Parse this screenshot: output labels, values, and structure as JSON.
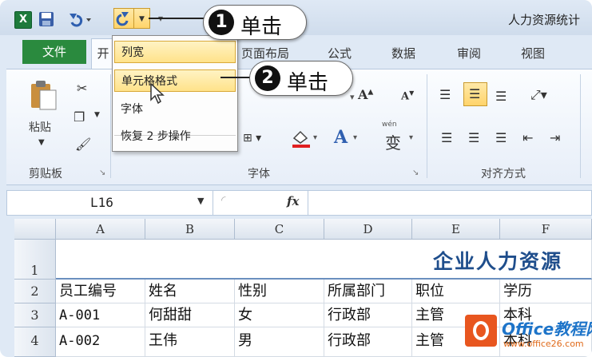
{
  "titlebar": {
    "doc_title": "人力资源统计"
  },
  "tabs": [
    {
      "label": "文件"
    },
    {
      "label": "开"
    },
    {
      "label": "页面布局"
    },
    {
      "label": "公式"
    },
    {
      "label": "数据"
    },
    {
      "label": "审阅"
    },
    {
      "label": "视图"
    }
  ],
  "menu": {
    "items": [
      {
        "label": "列宽"
      },
      {
        "label": "单元格格式"
      },
      {
        "label": "字体"
      },
      {
        "label": "恢复 2 步操作"
      }
    ]
  },
  "callouts": [
    {
      "number": "1",
      "text": "单击"
    },
    {
      "number": "2",
      "text": "单击"
    }
  ],
  "ribbon": {
    "clipboard": {
      "paste_label": "粘贴",
      "group_label": "剪贴板"
    },
    "font": {
      "group_label": "字体",
      "font_color_letter": "A",
      "phonetic_glyph": "变",
      "phonetic_top": "wén"
    },
    "alignment": {
      "group_label": "对齐方式"
    }
  },
  "formula_bar": {
    "name_box": "L16",
    "fx": "fx"
  },
  "sheet": {
    "columns": [
      "A",
      "B",
      "C",
      "D",
      "E",
      "F"
    ],
    "rows": [
      "1",
      "2",
      "3",
      "4"
    ],
    "title": "企业人力资源",
    "header_row": [
      "员工编号",
      "姓名",
      "性别",
      "所属部门",
      "职位",
      "学历"
    ],
    "data_rows": [
      [
        "A-001",
        "何甜甜",
        "女",
        "行政部",
        "主管",
        "本科"
      ],
      [
        "A-002",
        "王伟",
        "男",
        "行政部",
        "主管",
        "本科"
      ]
    ]
  },
  "watermark": {
    "text": "Office教程网",
    "sub": "www.office26.com"
  },
  "colors": {
    "file_tab": "#2a8a3e",
    "highlight": "#ffd46b",
    "title_blue": "#1f4e8c"
  }
}
